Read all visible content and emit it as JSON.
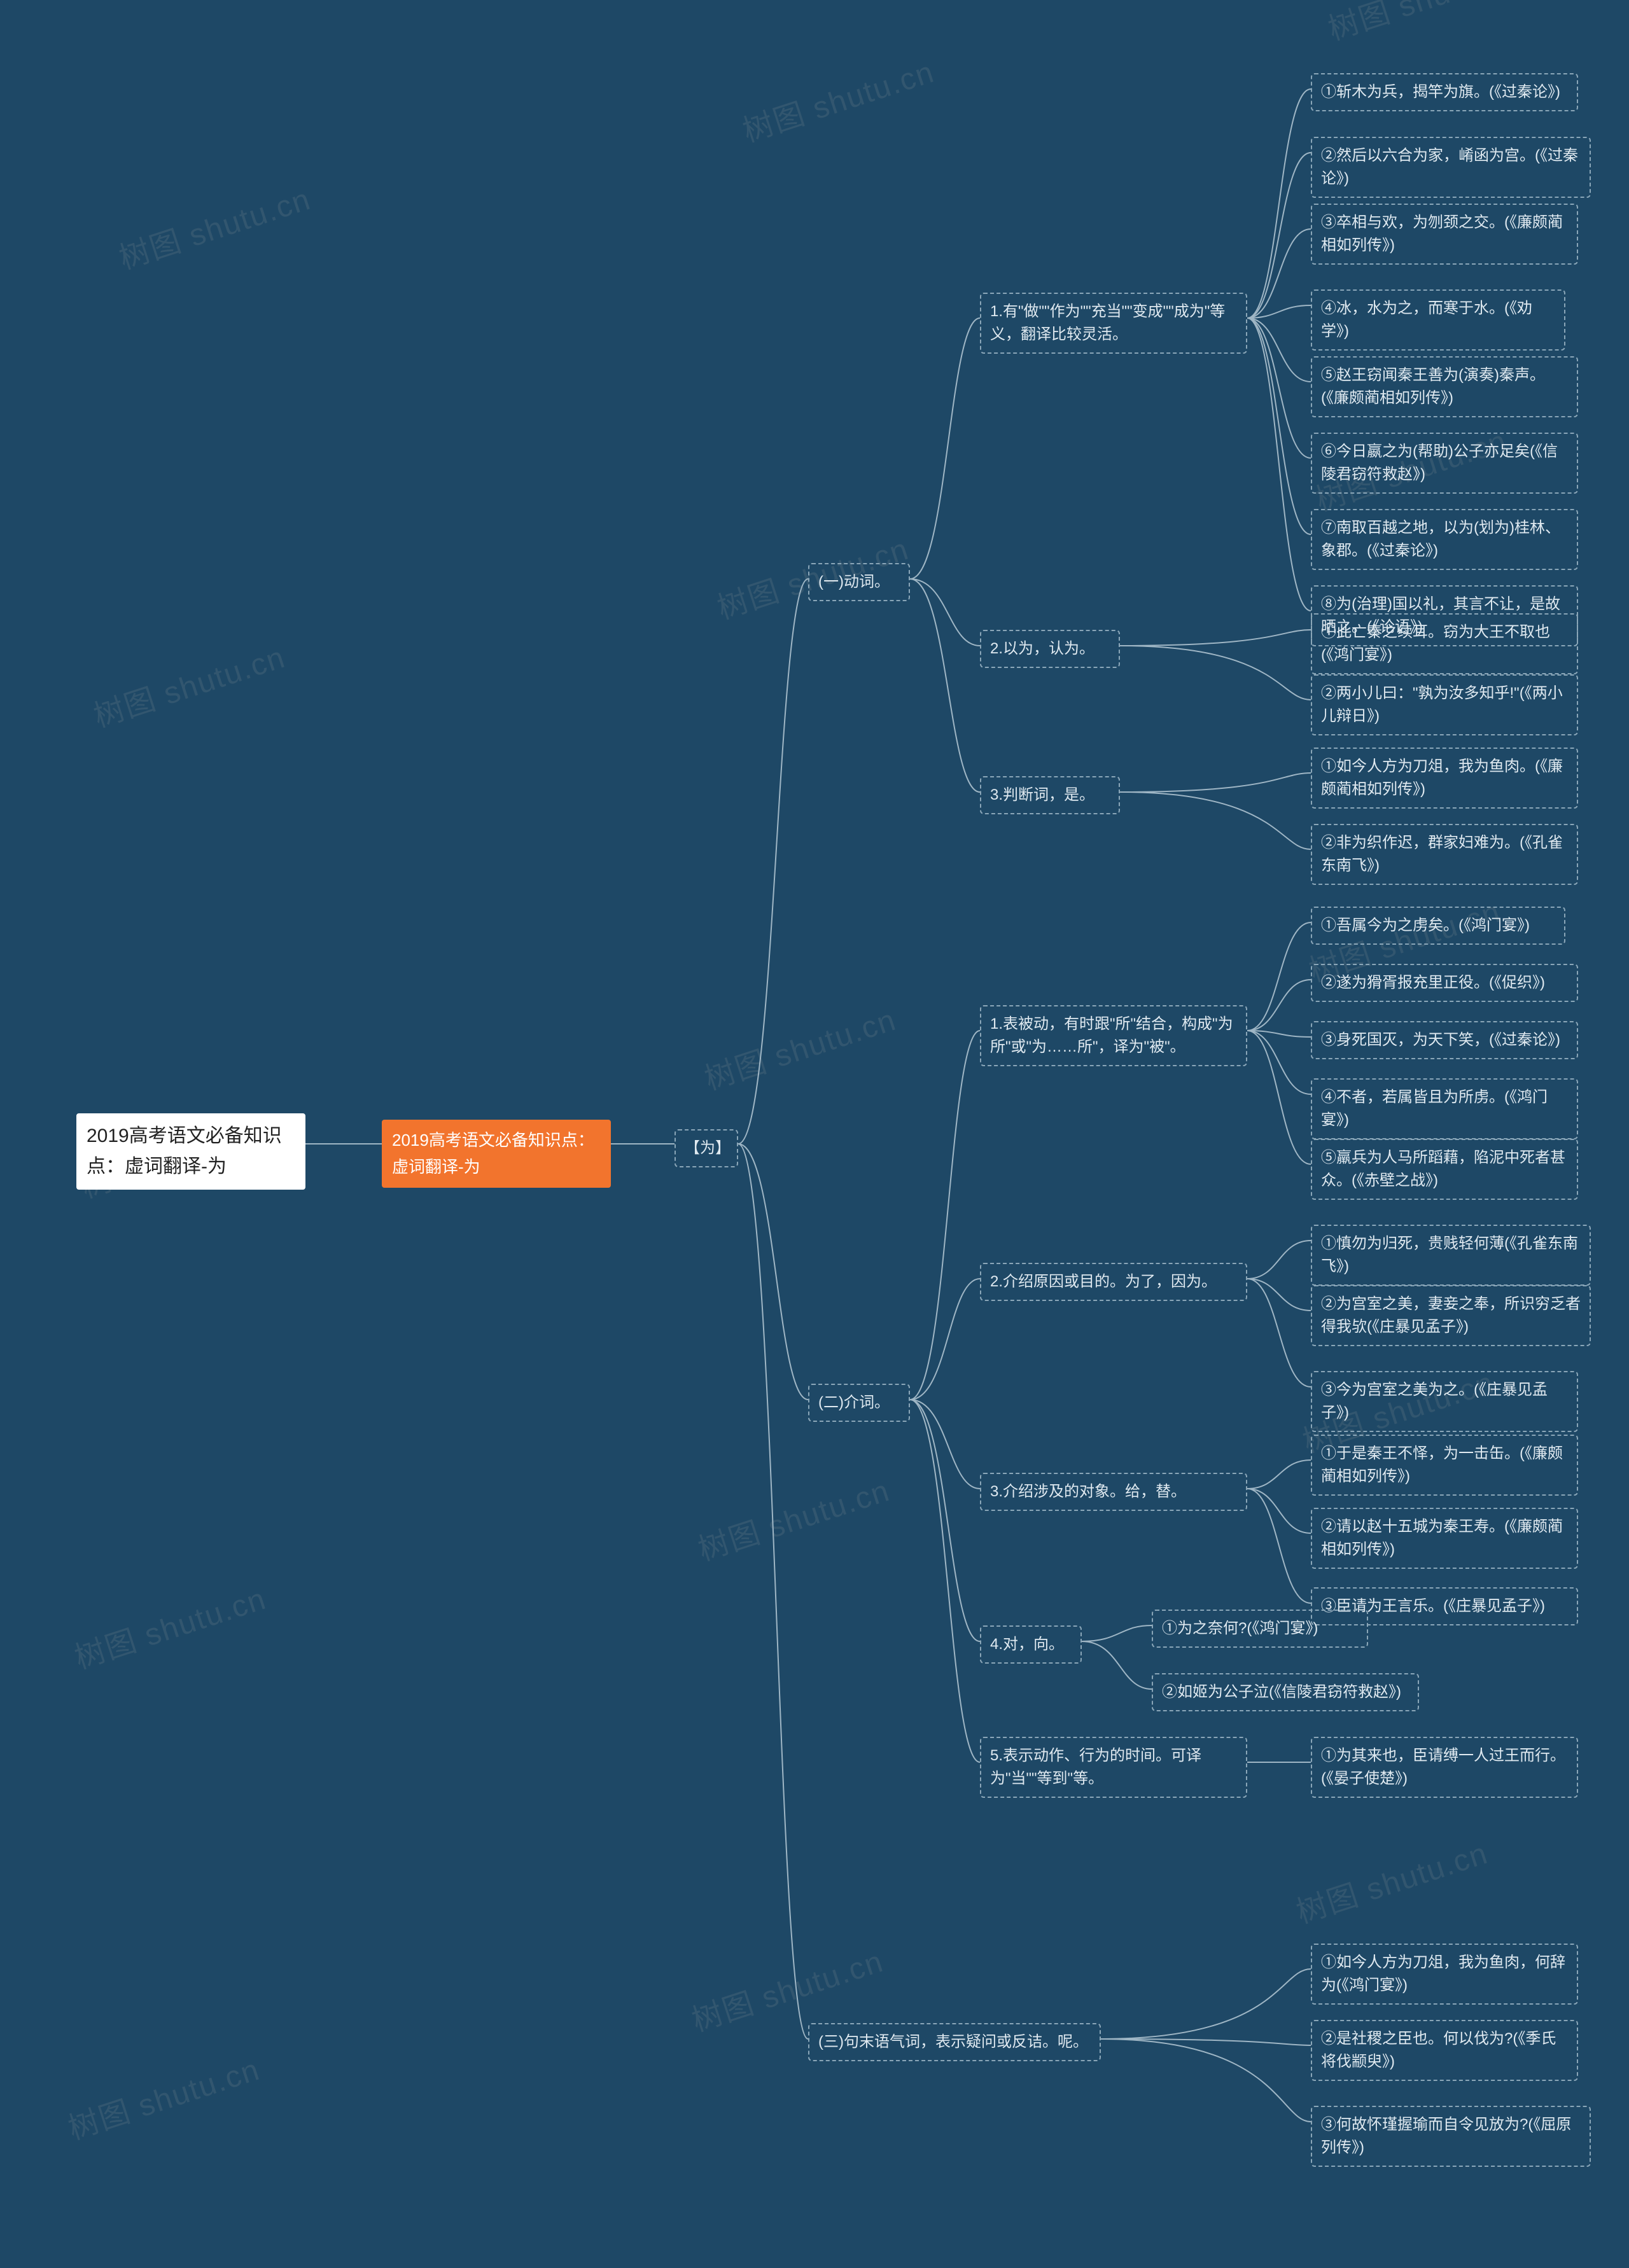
{
  "watermark": {
    "line1": "树图 shutu.cn",
    "line2": "shutu.cn"
  },
  "root": {
    "title": "2019高考语文必备知识点：虚词翻译-为"
  },
  "main": {
    "title": "2019高考语文必备知识点：虚词翻译-为"
  },
  "wei": {
    "label": "【为】"
  },
  "sec1": {
    "title": "(一)动词。",
    "g1": {
      "title": "1.有\"做\"\"作为\"\"充当\"\"变成\"\"成为\"等义，翻译比较灵活。",
      "i1": "①斩木为兵，揭竿为旗。(《过秦论》)",
      "i2": "②然后以六合为家，崤函为宫。(《过秦论》)",
      "i3": "③卒相与欢，为刎颈之交。(《廉颇蔺相如列传》)",
      "i4": "④冰，水为之，而寒于水。(《劝学》)",
      "i5": "⑤赵王窃闻秦王善为(演奏)秦声。(《廉颇蔺相如列传》)",
      "i6": "⑥今日嬴之为(帮助)公子亦足矣(《信陵君窃符救赵》)",
      "i7": "⑦南取百越之地，以为(划为)桂林、象郡。(《过秦论》)",
      "i8": "⑧为(治理)国以礼，其言不让，是故晒之。(《论语》)"
    },
    "g2": {
      "title": "2.以为，认为。",
      "i1": "①此亡秦之续耳。窃为大王不取也(《鸿门宴》)",
      "i2": "②两小儿曰：\"孰为汝多知乎!\"(《两小儿辩日》)"
    },
    "g3": {
      "title": "3.判断词，是。",
      "i1": "①如今人方为刀俎，我为鱼肉。(《廉颇蔺相如列传》)",
      "i2": "②非为织作迟，群家妇难为。(《孔雀东南飞》)"
    }
  },
  "sec2": {
    "title": "(二)介词。",
    "g1": {
      "title": "1.表被动，有时跟\"所\"结合，构成\"为所\"或\"为……所\"，译为\"被\"。",
      "i1": "①吾属今为之虏矣。(《鸿门宴》)",
      "i2": "②遂为猾胥报充里正役。(《促织》)",
      "i3": "③身死国灭，为天下笑，(《过秦论》)",
      "i4": "④不者，若属皆且为所虏。(《鸿门宴》)",
      "i5": "⑤羸兵为人马所蹈藉，陷泥中死者甚众。(《赤壁之战》)"
    },
    "g2": {
      "title": "2.介绍原因或目的。为了，因为。",
      "i1": "①慎勿为归死，贵贱轻何薄(《孔雀东南飞》)",
      "i2": "②为宫室之美，妻妾之奉，所识穷乏者得我欤(《庄暴见孟子》)",
      "i3": "③今为宫室之美为之。(《庄暴见孟子》)"
    },
    "g3": {
      "title": "3.介绍涉及的对象。给，替。",
      "i1": "①于是秦王不怿，为一击缶。(《廉颇蔺相如列传》)",
      "i2": "②请以赵十五城为秦王寿。(《廉颇蔺相如列传》)",
      "i3": "③臣请为王言乐。(《庄暴见孟子》)"
    },
    "g4": {
      "title": "4.对，向。",
      "i1": "①为之奈何?(《鸿门宴》)",
      "i2": "②如姬为公子泣(《信陵君窃符救赵》)"
    },
    "g5": {
      "title": "5.表示动作、行为的时间。可译为\"当\"\"等到\"等。",
      "i1": "①为其来也，臣请缚一人过王而行。(《晏子使楚》)"
    }
  },
  "sec3": {
    "title": "(三)句末语气词，表示疑问或反诘。呢。",
    "i1": "①如今人方为刀俎，我为鱼肉，何辞为(《鸿门宴》)",
    "i2": "②是社稷之臣也。何以伐为?(《季氏将伐颛臾》)",
    "i3": "③何故怀瑾握瑜而自令见放为?(《屈原列传》)"
  }
}
